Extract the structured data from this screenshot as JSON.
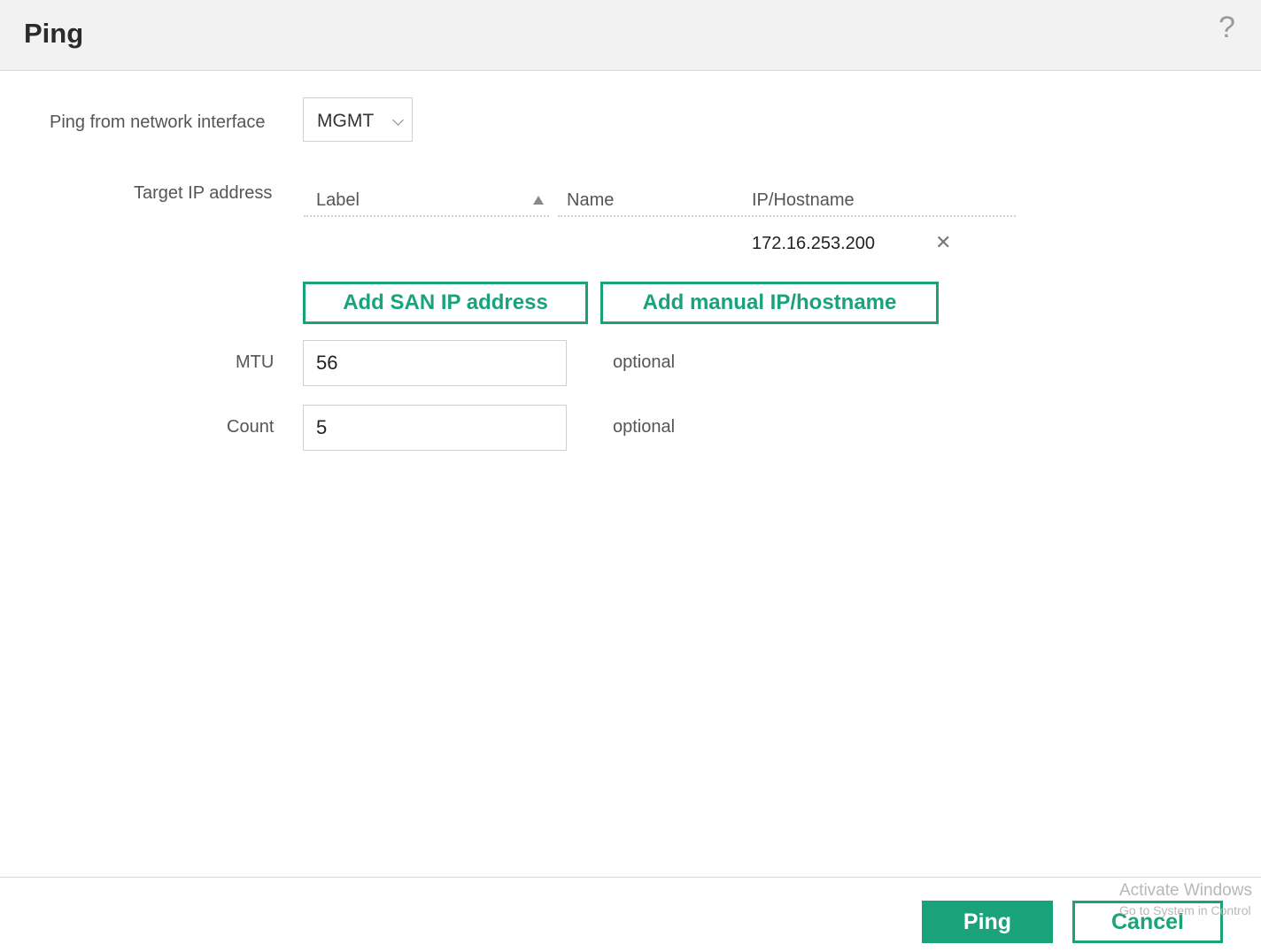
{
  "dialog": {
    "title": "Ping",
    "help_glyph": "?"
  },
  "form": {
    "interface_label": "Ping from network interface",
    "interface_value": "MGMT",
    "target_label": "Target IP address",
    "mtu_label": "MTU",
    "mtu_value": "56",
    "mtu_hint": "optional",
    "count_label": "Count",
    "count_value": "5",
    "count_hint": "optional"
  },
  "targets_table": {
    "columns": [
      "Label",
      "Name",
      "IP/Hostname"
    ],
    "sort_column": "Label",
    "rows": [
      {
        "label": "",
        "name": "",
        "ip": "172.16.253.200"
      }
    ],
    "remove_glyph": "✕"
  },
  "actions": {
    "add_san": "Add SAN IP address",
    "add_manual": "Add manual IP/hostname"
  },
  "footer": {
    "ping": "Ping",
    "cancel": "Cancel"
  },
  "watermark": {
    "line1": "Activate Windows",
    "line2": "Go to System in Control"
  },
  "colors": {
    "accent": "#1aa37a",
    "header_bg": "#f2f2f2"
  }
}
